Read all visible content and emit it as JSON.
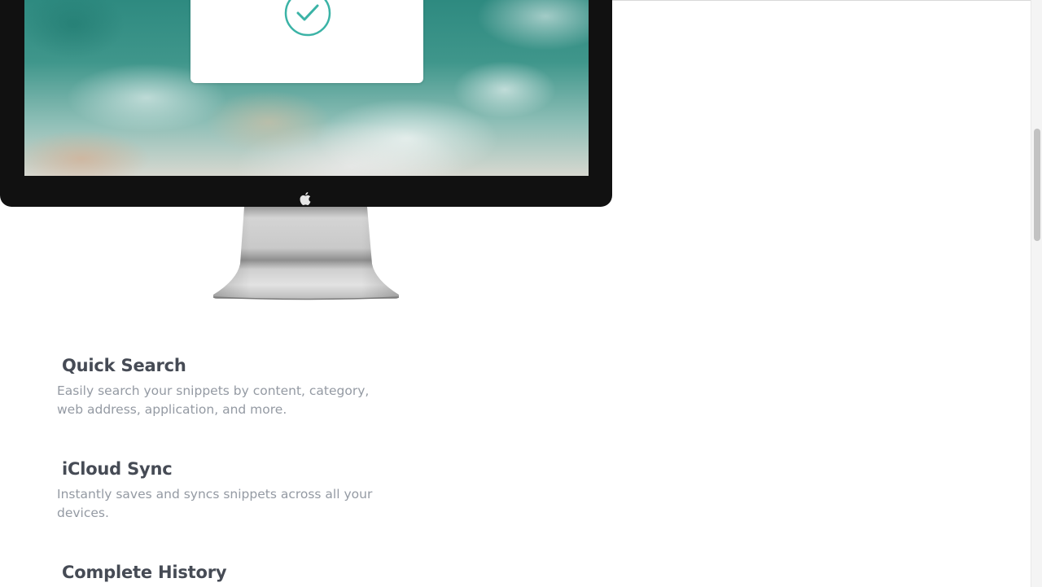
{
  "features": [
    {
      "title": "Quick Search",
      "description": "Easily search your snippets by content, category, web address, application, and more."
    },
    {
      "title": "iCloud Sync",
      "description": "Instantly saves and syncs snippets across all your devices."
    },
    {
      "title": "Complete History",
      "description": ""
    }
  ],
  "icons": {
    "check": "check-circle-icon",
    "apple": "apple-logo-icon"
  },
  "colors": {
    "accent": "#3bb3a6",
    "heading": "#464b55",
    "body_text": "#949aa3",
    "bezel": "#111111"
  },
  "scroll": {
    "position_fraction": 0.22
  }
}
